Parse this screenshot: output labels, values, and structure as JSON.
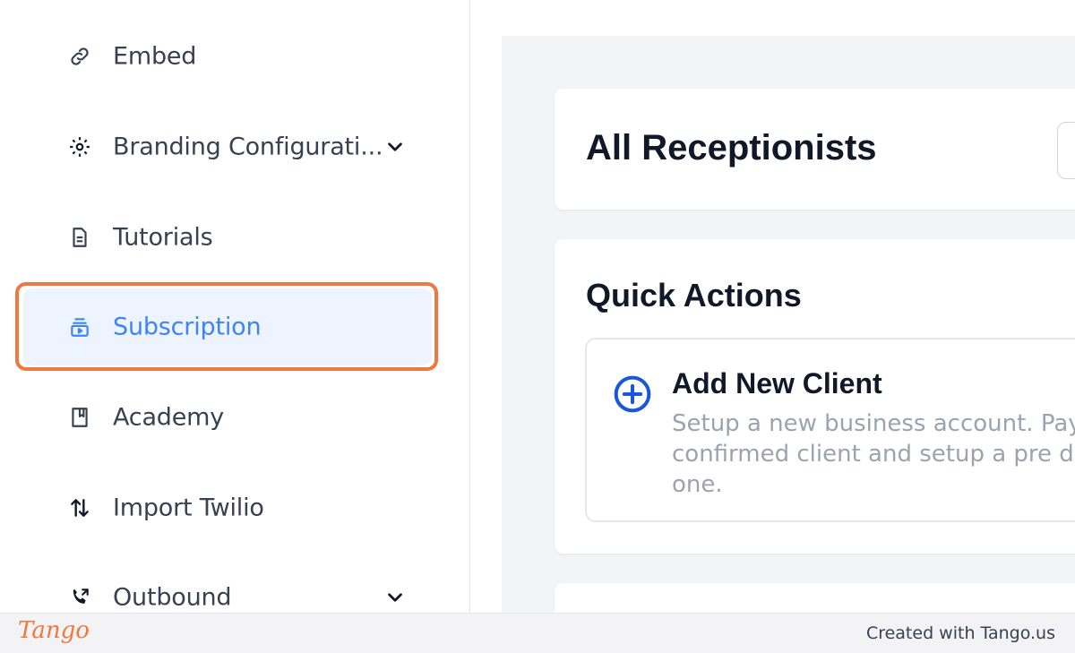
{
  "sidebar": {
    "items": [
      {
        "label": "Embed",
        "icon": "link-icon",
        "has_chevron": false
      },
      {
        "label": "Branding Configurati...",
        "icon": "gear-icon",
        "has_chevron": true
      },
      {
        "label": "Tutorials",
        "icon": "document-icon",
        "has_chevron": false
      },
      {
        "label": "Subscription",
        "icon": "subscription-icon",
        "has_chevron": false,
        "active": true
      },
      {
        "label": "Academy",
        "icon": "book-icon",
        "has_chevron": false
      },
      {
        "label": "Import Twilio",
        "icon": "arrows-up-down-icon",
        "has_chevron": false
      },
      {
        "label": "Outbound",
        "icon": "phone-forward-icon",
        "has_chevron": true
      }
    ]
  },
  "main": {
    "header_title": "All Receptionists",
    "quick_actions": {
      "title": "Quick Actions",
      "action": {
        "title": "Add New Client",
        "description": "Setup a new business account. Pay a confirmed client and setup a pre day one."
      }
    }
  },
  "footer": {
    "brand": "Tango",
    "credit": "Created with Tango.us"
  },
  "colors": {
    "accent": "#3f83f8",
    "highlight": "#f0783f",
    "active_bg": "#eef4ff"
  }
}
